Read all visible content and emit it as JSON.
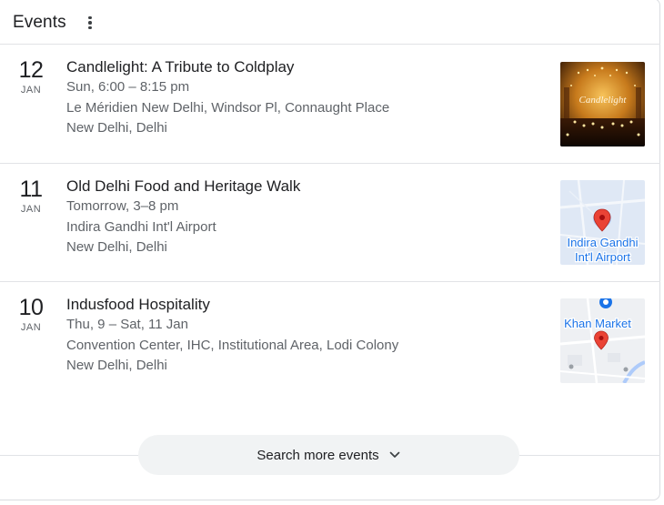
{
  "header": {
    "title": "Events",
    "more_icon": "more-vert-icon"
  },
  "events": [
    {
      "day": "12",
      "month": "JAN",
      "title": "Candlelight: A Tribute to Coldplay",
      "time": "Sun, 6:00 – 8:15 pm",
      "venue": "Le Méridien New Delhi, Windsor Pl, Connaught Place",
      "city": "New Delhi, Delhi",
      "thumb_text": "Candlelight"
    },
    {
      "day": "11",
      "month": "JAN",
      "title": "Old Delhi Food and Heritage Walk",
      "time": "Tomorrow, 3–8 pm",
      "venue": "Indira Gandhi Int'l Airport",
      "city": "New Delhi, Delhi",
      "thumb_text_1": "Indira Gandhi",
      "thumb_text_2": "Int'l Airport"
    },
    {
      "day": "10",
      "month": "JAN",
      "title": "Indusfood Hospitality",
      "time": "Thu, 9 – Sat, 11 Jan",
      "venue": "Convention Center, IHC, Institutional Area, Lodi Colony",
      "city": "New Delhi, Delhi",
      "thumb_text": "Khan Market"
    }
  ],
  "search_more": {
    "label": "Search more events",
    "icon": "chevron-down-icon"
  },
  "colors": {
    "text_primary": "#202124",
    "text_secondary": "#5f6368",
    "divider": "#e1e3e6",
    "button_bg": "#f1f3f4",
    "map_pin": "#ea4335",
    "map_label": "#1a73e8"
  }
}
